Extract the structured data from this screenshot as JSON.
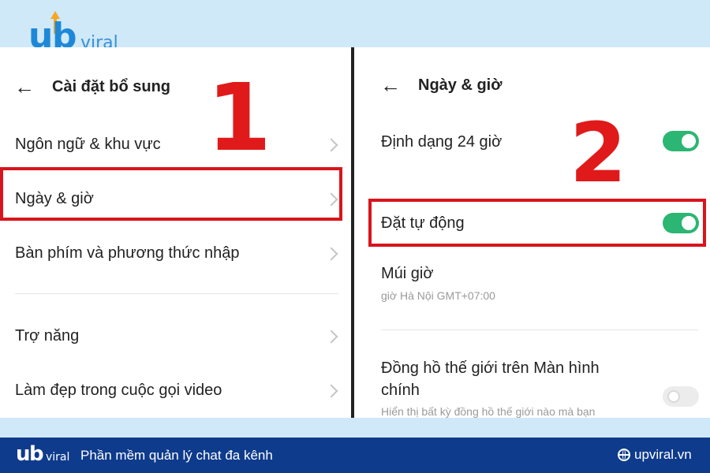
{
  "branding": {
    "logo_u": "u",
    "logo_b": "b",
    "logo_viral": "viral",
    "brand_blue": "#1e88d8",
    "accent_orange": "#f5a623"
  },
  "left_panel": {
    "title": "Cài đặt bổ sung",
    "step_number": "1",
    "items": [
      {
        "label": "Ngôn ngữ & khu vực"
      },
      {
        "label": "Ngày & giờ"
      },
      {
        "label": "Bàn phím và phương thức nhập"
      },
      {
        "label": "Trợ năng"
      },
      {
        "label": "Làm đẹp trong cuộc gọi video"
      }
    ]
  },
  "right_panel": {
    "title": "Ngày & giờ",
    "step_number": "2",
    "format_24h": {
      "label": "Định dạng 24 giờ",
      "enabled": true
    },
    "auto_set": {
      "label": "Đặt tự động",
      "enabled": true
    },
    "timezone": {
      "label": "Múi giờ",
      "value": "giờ Hà Nội GMT+07:00"
    },
    "world_clock": {
      "label_line1": "Đồng hồ thế giới trên Màn hình",
      "label_line2": "chính",
      "description": "Hiển thị bất kỳ đồng hồ thế giới nào mà bạn",
      "enabled": false
    }
  },
  "footer": {
    "tagline": "Phần mềm quản lý chat đa kênh",
    "site": "upviral.vn",
    "background": "#0e3b8c"
  },
  "colors": {
    "highlight_red": "#d9141b",
    "toggle_on": "#2bb673"
  }
}
